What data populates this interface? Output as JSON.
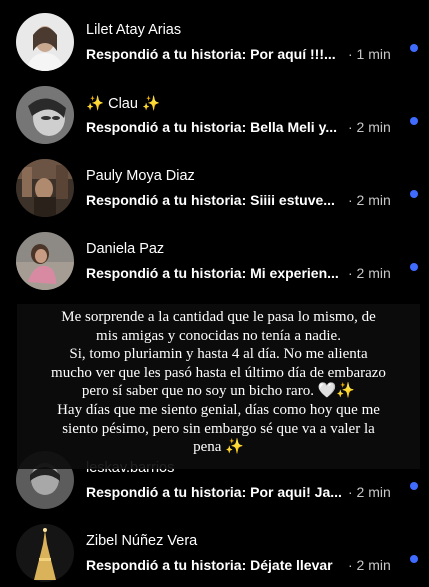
{
  "conversations": [
    {
      "name": "Lilet Atay Arias",
      "message": "Respondió a tu historia: Por aquí !!!...",
      "time": "· 1 min",
      "unread": true
    },
    {
      "name_prefix": "✨",
      "name": "Clau",
      "name_suffix": "✨",
      "message": "Respondió a tu historia: Bella Meli y...",
      "time": "· 2 min",
      "unread": true
    },
    {
      "name": "Pauly Moya Diaz",
      "message": "Respondió a tu historia: Siiii estuve...",
      "time": "· 2 min",
      "unread": true
    },
    {
      "name": "Daniela Paz",
      "message": "Respondió a tu historia: Mi experien...",
      "time": "· 2 min",
      "unread": true
    },
    {
      "name": "leskav.barrios",
      "message": "Respondió a tu historia: Por aqui! Ja...",
      "time": "· 2 min",
      "unread": true
    },
    {
      "name": "Zibel Núñez Vera",
      "message": "Respondió a tu historia: Déjate llevar",
      "time": "· 2 min",
      "unread": true
    }
  ],
  "overlay_lines": [
    "Me sorprende a la cantidad que le pasa lo mismo, de",
    "mis amigas y conocidas no tenía a nadie.",
    "Si, tomo pluriamin y hasta 4 al día. No me alienta",
    "mucho ver que les pasó hasta el último día de embarazo",
    "pero sí saber que no soy un bicho raro. 🤍✨",
    "Hay días que me siento genial, días como hoy que me",
    "siento pésimo, pero sin embargo sé que va a valer la",
    "pena ✨"
  ],
  "colors": {
    "unread_dot": "#3f6bff",
    "background": "#000000"
  }
}
